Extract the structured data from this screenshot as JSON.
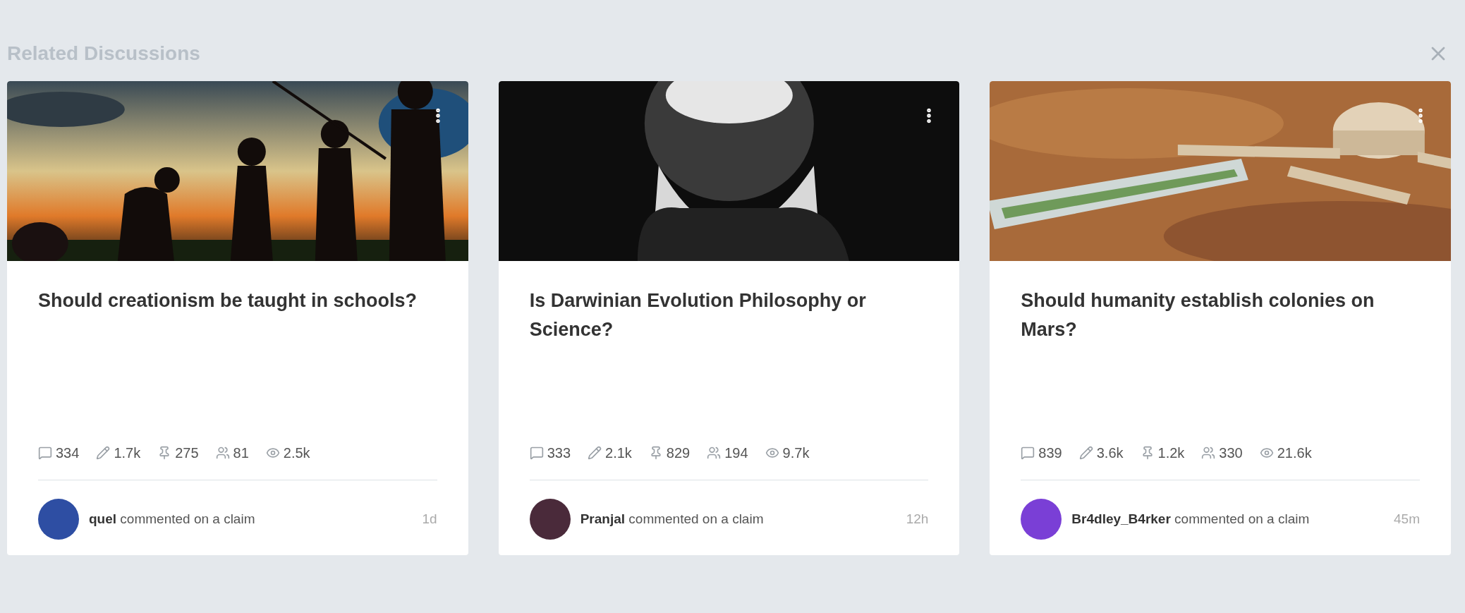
{
  "section": {
    "title": "Related Discussions"
  },
  "cards": [
    {
      "title": "Should creationism be taught in schools?",
      "stats": [
        {
          "kind": "comments",
          "value": "334"
        },
        {
          "kind": "edits",
          "value": "1.7k"
        },
        {
          "kind": "claims",
          "value": "275"
        },
        {
          "kind": "contributors",
          "value": "81"
        },
        {
          "kind": "views",
          "value": "2.5k"
        }
      ],
      "activity": {
        "user": "quel",
        "action": "commented on a claim",
        "time": "1d",
        "color": "#2e4ea3"
      }
    },
    {
      "title": "Is Darwinian Evolution Philosophy or Science?",
      "stats": [
        {
          "kind": "comments",
          "value": "333"
        },
        {
          "kind": "edits",
          "value": "2.1k"
        },
        {
          "kind": "claims",
          "value": "829"
        },
        {
          "kind": "contributors",
          "value": "194"
        },
        {
          "kind": "views",
          "value": "9.7k"
        }
      ],
      "activity": {
        "user": "Pranjal",
        "action": "commented on a claim",
        "time": "12h",
        "color": "#4a2a3a"
      }
    },
    {
      "title": "Should humanity establish colonies on Mars?",
      "stats": [
        {
          "kind": "comments",
          "value": "839"
        },
        {
          "kind": "edits",
          "value": "3.6k"
        },
        {
          "kind": "claims",
          "value": "1.2k"
        },
        {
          "kind": "contributors",
          "value": "330"
        },
        {
          "kind": "views",
          "value": "21.6k"
        }
      ],
      "activity": {
        "user": "Br4dley_B4rker",
        "action": "commented on a claim",
        "time": "45m",
        "color": "#7a3fd6"
      }
    }
  ]
}
